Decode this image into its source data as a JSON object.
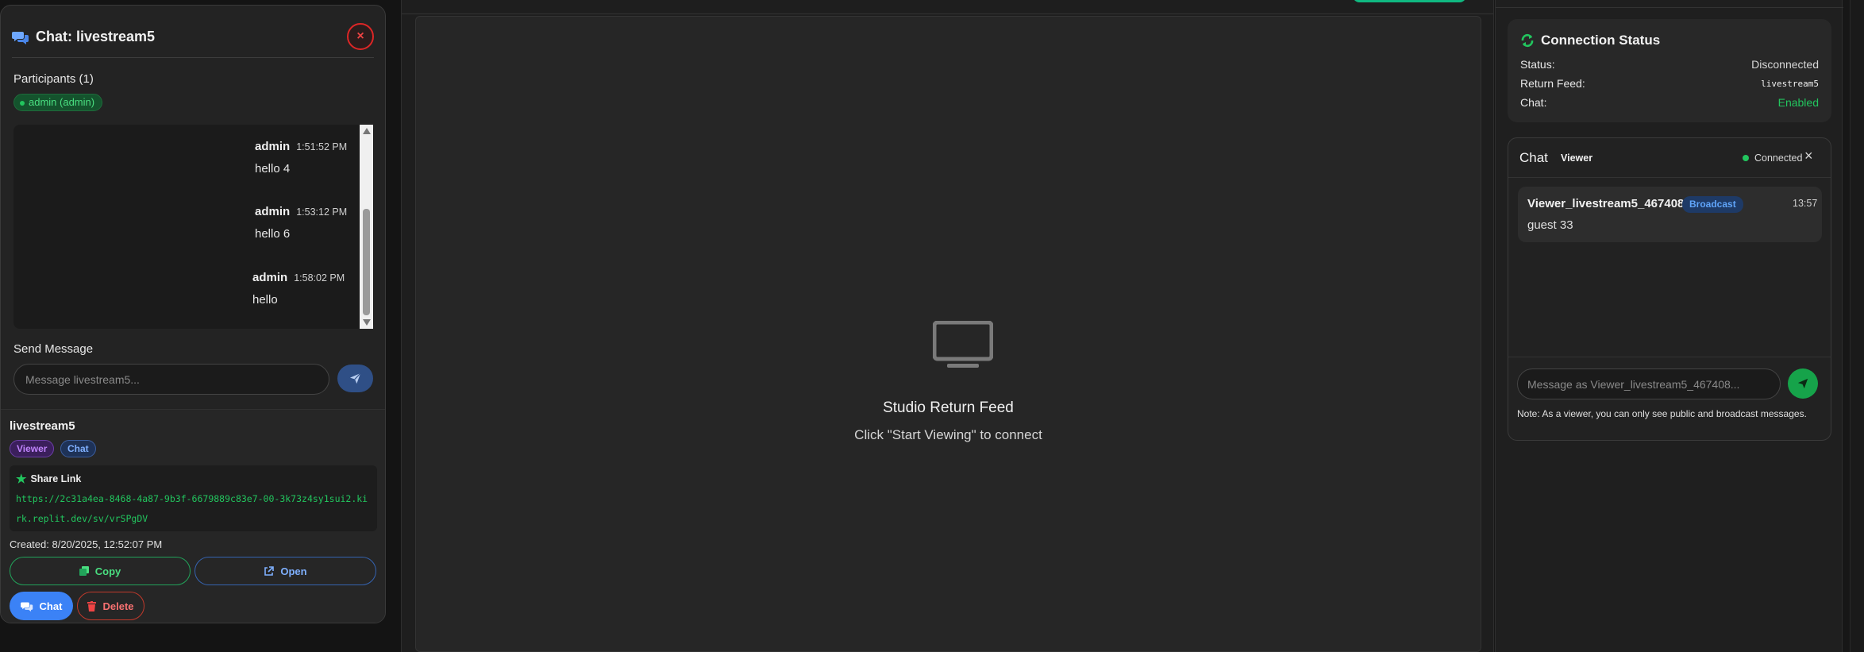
{
  "chat_modal": {
    "title": "Chat: livestream5",
    "close_symbol": "×",
    "participants_label": "Participants (1)",
    "participants": [
      "admin (admin)"
    ],
    "messages": [
      {
        "author": "admin",
        "time": "1:51:52 PM",
        "text": "hello 4"
      },
      {
        "author": "admin",
        "time": "1:53:12 PM",
        "text": "hello 6"
      },
      {
        "author": "admin",
        "time": "1:58:02 PM",
        "text": "hello"
      }
    ],
    "send_label": "Send Message",
    "send_placeholder": "Message livestream5..."
  },
  "stream_card": {
    "name": "livestream5",
    "tags": [
      "Viewer",
      "Chat"
    ],
    "share_label": "Share Link",
    "share_url": "https://2c31a4ea-8468-4a87-9b3f-6679889c83e7-00-3k73z4sy1sui2.kirk.replit.dev/sv/vrSPgDV",
    "created": "Created: 8/20/2025, 12:52:07 PM",
    "copy_label": "Copy",
    "open_label": "Open",
    "chat_label": "Chat",
    "delete_label": "Delete"
  },
  "center": {
    "feed_title": "Studio Return Feed",
    "feed_subtitle": "Click \"Start Viewing\" to connect"
  },
  "connection": {
    "title": "Connection Status",
    "status_label": "Status:",
    "status_value": "Disconnected",
    "return_feed_label": "Return Feed:",
    "return_feed_value": "livestream5",
    "chat_label": "Chat:",
    "chat_value": "Enabled"
  },
  "viewer_chat": {
    "title": "Chat",
    "role": "Viewer",
    "status": "Connected",
    "close_symbol": "×",
    "message": {
      "author": "Viewer_livestream5_467408",
      "tag": "Broadcast",
      "time": "13:57",
      "text": "guest 33"
    },
    "input_placeholder": "Message as Viewer_livestream5_467408...",
    "note": "Note: As a viewer, you can only see public and broadcast messages."
  },
  "colors": {
    "accent_green": "#22c55e",
    "accent_blue": "#3b82f6",
    "danger_red": "#dc2626",
    "background": "#171717"
  }
}
